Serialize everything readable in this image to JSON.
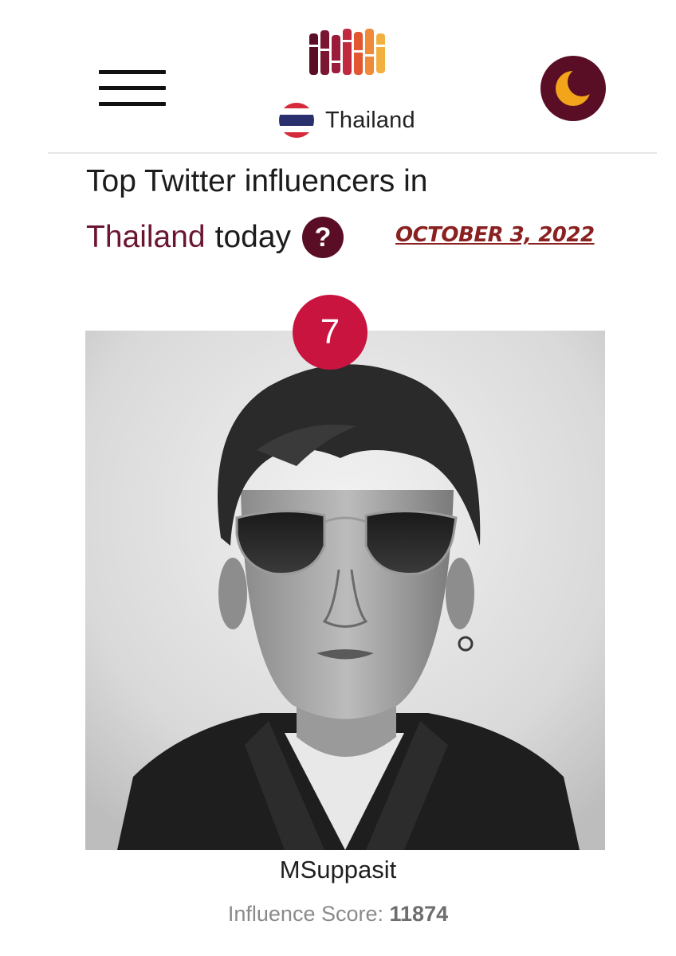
{
  "header": {
    "country_label": "Thailand"
  },
  "page": {
    "title_line1": "Top Twitter influencers in",
    "title_country": "Thailand",
    "title_suffix": "today",
    "help_symbol": "?",
    "date": "OCTOBER 3, 2022"
  },
  "influencer": {
    "rank": "7",
    "username": "MSuppasit",
    "score_label": "Influence Score:",
    "score_value": "11874"
  },
  "icons": {
    "menu": "hamburger-menu-icon",
    "logo": "site-logo-bars-icon",
    "flag": "thailand-flag-icon",
    "theme": "moon-icon",
    "help": "question-mark-icon"
  },
  "colors": {
    "brand": "#5a0e26",
    "accent_text": "#6b1630",
    "date_link": "#8a2020",
    "rank_badge": "#c8143f",
    "moon": "#f2a51a",
    "logo_bars": [
      "#5a0e26",
      "#7a1532",
      "#9a1c3a",
      "#c02a3e",
      "#e2572f",
      "#ef8a3a",
      "#f2b13e"
    ]
  }
}
